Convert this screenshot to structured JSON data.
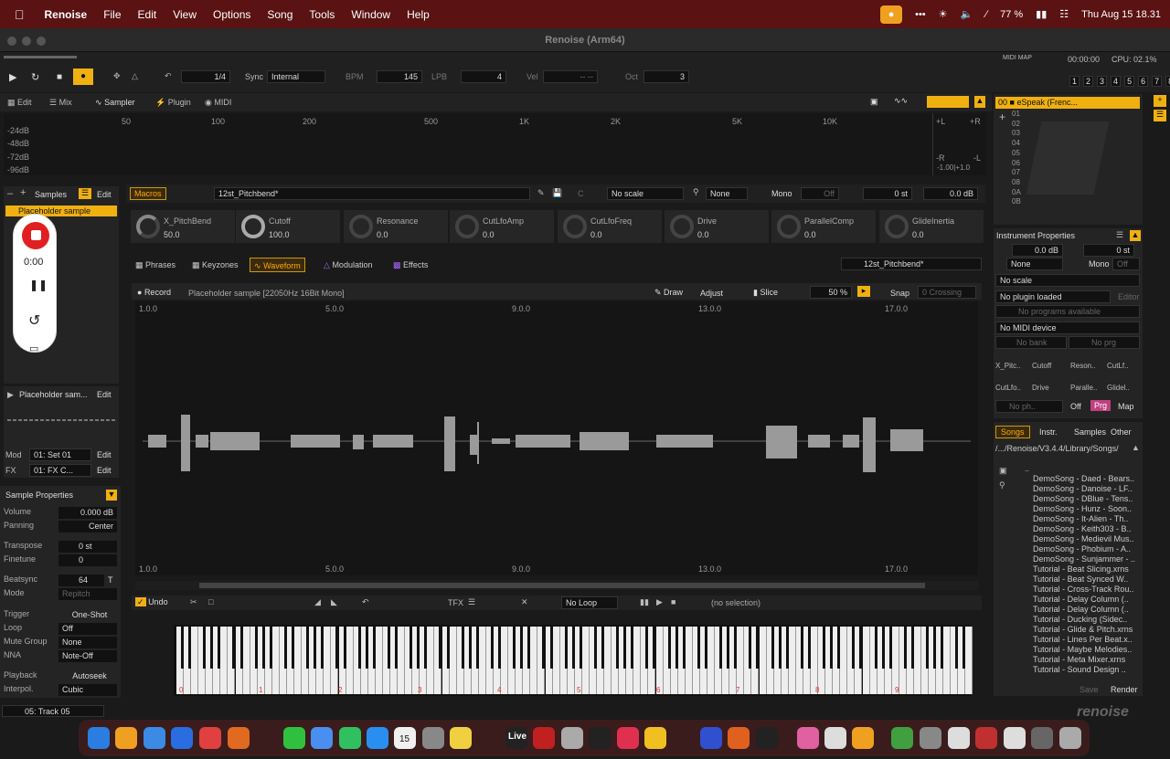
{
  "menubar": {
    "app": "Renoise",
    "items": [
      "File",
      "Edit",
      "View",
      "Options",
      "Song",
      "Tools",
      "Window",
      "Help"
    ],
    "battery": "77 %",
    "datetime": "Thu Aug 15  18.31"
  },
  "window": {
    "title": "Renoise (Arm64)"
  },
  "transport": {
    "pattern_step": "1/4",
    "sync_label": "Sync",
    "sync": "Internal",
    "bpm_label": "BPM",
    "bpm": "145",
    "lpb_label": "LPB",
    "lpb": "4",
    "vel_label": "Vel",
    "vel": "-- --",
    "oct_label": "Oct",
    "oct": "3",
    "midi_map": "MIDI MAP",
    "time": "00:00:00",
    "cpu": "CPU: 02.1%",
    "tracks": [
      "1",
      "2",
      "3",
      "4",
      "5",
      "6",
      "7",
      "8"
    ]
  },
  "view_tabs": {
    "edit": "Edit",
    "mix": "Mix",
    "sampler": "Sampler",
    "plugin": "Plugin",
    "midi": "MIDI"
  },
  "spectrum": {
    "freqs": [
      "50",
      "100",
      "200",
      "500",
      "1K",
      "2K",
      "5K",
      "10K"
    ],
    "db": [
      "-24dB",
      "-48dB",
      "-72dB",
      "-96dB"
    ],
    "l": "+L",
    "r": "+R",
    "rl": "-R",
    "ll": "-L",
    "range": "-1.00|+1.0"
  },
  "instruments": {
    "selected": "00",
    "name": "eSpeak (Frenc...",
    "rows": [
      "01",
      "02",
      "03",
      "04",
      "05",
      "06",
      "07",
      "08",
      "0A",
      "0B"
    ]
  },
  "samples_panel": {
    "title": "Samples",
    "edit": "Edit",
    "item": "Placeholder sample",
    "item2": "Placeholder sam...",
    "edit2": "Edit",
    "mod_label": "Mod",
    "mod": "01: Set 01",
    "mod_edit": "Edit",
    "fx_label": "FX",
    "fx": "01: FX C...",
    "fx_edit": "Edit"
  },
  "recorder": {
    "time": "0:00"
  },
  "sample_props": {
    "title": "Sample Properties",
    "rows": [
      {
        "label": "Volume",
        "value": "0.000 dB"
      },
      {
        "label": "Panning",
        "value": "Center"
      },
      {
        "label": "Transpose",
        "value": "0 st"
      },
      {
        "label": "Finetune",
        "value": "0"
      },
      {
        "label": "Beatsync",
        "value": "64"
      },
      {
        "label": "Mode",
        "value": "Repitch"
      },
      {
        "label": "Trigger",
        "value": "One-Shot"
      },
      {
        "label": "Loop",
        "value": "Off"
      },
      {
        "label": "Mute Group",
        "value": "None"
      },
      {
        "label": "NNA",
        "value": "Note-Off"
      },
      {
        "label": "Playback",
        "value": "Autoseek"
      },
      {
        "label": "Interpol.",
        "value": "Cubic"
      }
    ],
    "track": "05: Track 05",
    "beatsync_t": "T"
  },
  "macros": {
    "label": "Macros",
    "preset": "12st_Pitchbend*",
    "key": "C",
    "scale": "No scale",
    "scale2": "None",
    "mono": "Mono",
    "off": "Off",
    "st": "0 st",
    "db": "0.0 dB",
    "knobs": [
      {
        "name": "X_PitchBend",
        "value": "50.0"
      },
      {
        "name": "Cutoff",
        "value": "100.0"
      },
      {
        "name": "Resonance",
        "value": "0.0"
      },
      {
        "name": "CutLfoAmp",
        "value": "0.0"
      },
      {
        "name": "CutLfoFreq",
        "value": "0.0"
      },
      {
        "name": "Drive",
        "value": "0.0"
      },
      {
        "name": "ParallelComp",
        "value": "0.0"
      },
      {
        "name": "GlideInertia",
        "value": "0.0"
      }
    ]
  },
  "editor_tabs": {
    "phrases": "Phrases",
    "keyzones": "Keyzones",
    "waveform": "Waveform",
    "modulation": "Modulation",
    "effects": "Effects",
    "preset": "12st_Pitchbend*"
  },
  "waveform": {
    "record": "Record",
    "info": "Placeholder sample [22050Hz 16Bit Mono]",
    "draw": "Draw",
    "adjust": "Adjust",
    "slice": "Slice",
    "zoom": "50",
    "zoom_unit": "%",
    "snap": "Snap",
    "crossing": "0 Crossing",
    "ruler": [
      "1.0.0",
      "5.0.0",
      "9.0.0",
      "13.0.0",
      "17.0.0"
    ],
    "undo": "Undo",
    "loop": "No Loop",
    "selection": "(no selection)",
    "tfx": "TFX"
  },
  "instrument_props": {
    "title": "Instrument Properties",
    "db": "0.0 dB",
    "st": "0 st",
    "none": "None",
    "mono": "Mono",
    "off": "Off",
    "scale": "No scale",
    "plugin": "No plugin loaded",
    "editor": "Editor",
    "programs": "No programs available",
    "midi": "No MIDI device",
    "bank": "No bank",
    "prg": "No prg",
    "macros": [
      "X_Pitc..",
      "Cutoff",
      "Reson..",
      "CutLf..",
      "CutLfo..",
      "Drive",
      "Paralle..",
      "Glidel.."
    ],
    "noph": "No ph..",
    "off2": "Off",
    "prg2": "Prg",
    "map": "Map"
  },
  "browser": {
    "tabs": [
      "Songs",
      "Instr.",
      "Samples",
      "Other"
    ],
    "path": "/.../Renoise/V3.4.4/Library/Songs/",
    "up": "..",
    "files": [
      "DemoSong - Daed - Bears..",
      "DemoSong - Danoise - LF..",
      "DemoSong - DBlue - Tens..",
      "DemoSong - Hunz - Soon..",
      "DemoSong - It-Alien - Th..",
      "DemoSong - Keith303 - B..",
      "DemoSong - Medievil Mus..",
      "DemoSong - Phobium - A..",
      "DemoSong - Sunjammer - ..",
      "Tutorial - Beat Slicing.xrns",
      "Tutorial - Beat Synced W..",
      "Tutorial - Cross-Track Rou..",
      "Tutorial - Delay Column (..",
      "Tutorial - Delay Column (..",
      "Tutorial - Ducking (Sidec..",
      "Tutorial - Glide & Pitch.xrns",
      "Tutorial - Lines Per Beat.x..",
      "Tutorial - Maybe Melodies..",
      "Tutorial - Meta Mixer.xrns",
      "Tutorial - Sound Design .."
    ],
    "save": "Save",
    "render": "Render"
  },
  "keyboard": {
    "octaves": [
      "0",
      "1",
      "2",
      "3",
      "4",
      "5",
      "6",
      "7",
      "8",
      "9"
    ]
  },
  "brand": "renoise",
  "dock": {
    "live": "Live",
    "calendar_day": "15"
  }
}
